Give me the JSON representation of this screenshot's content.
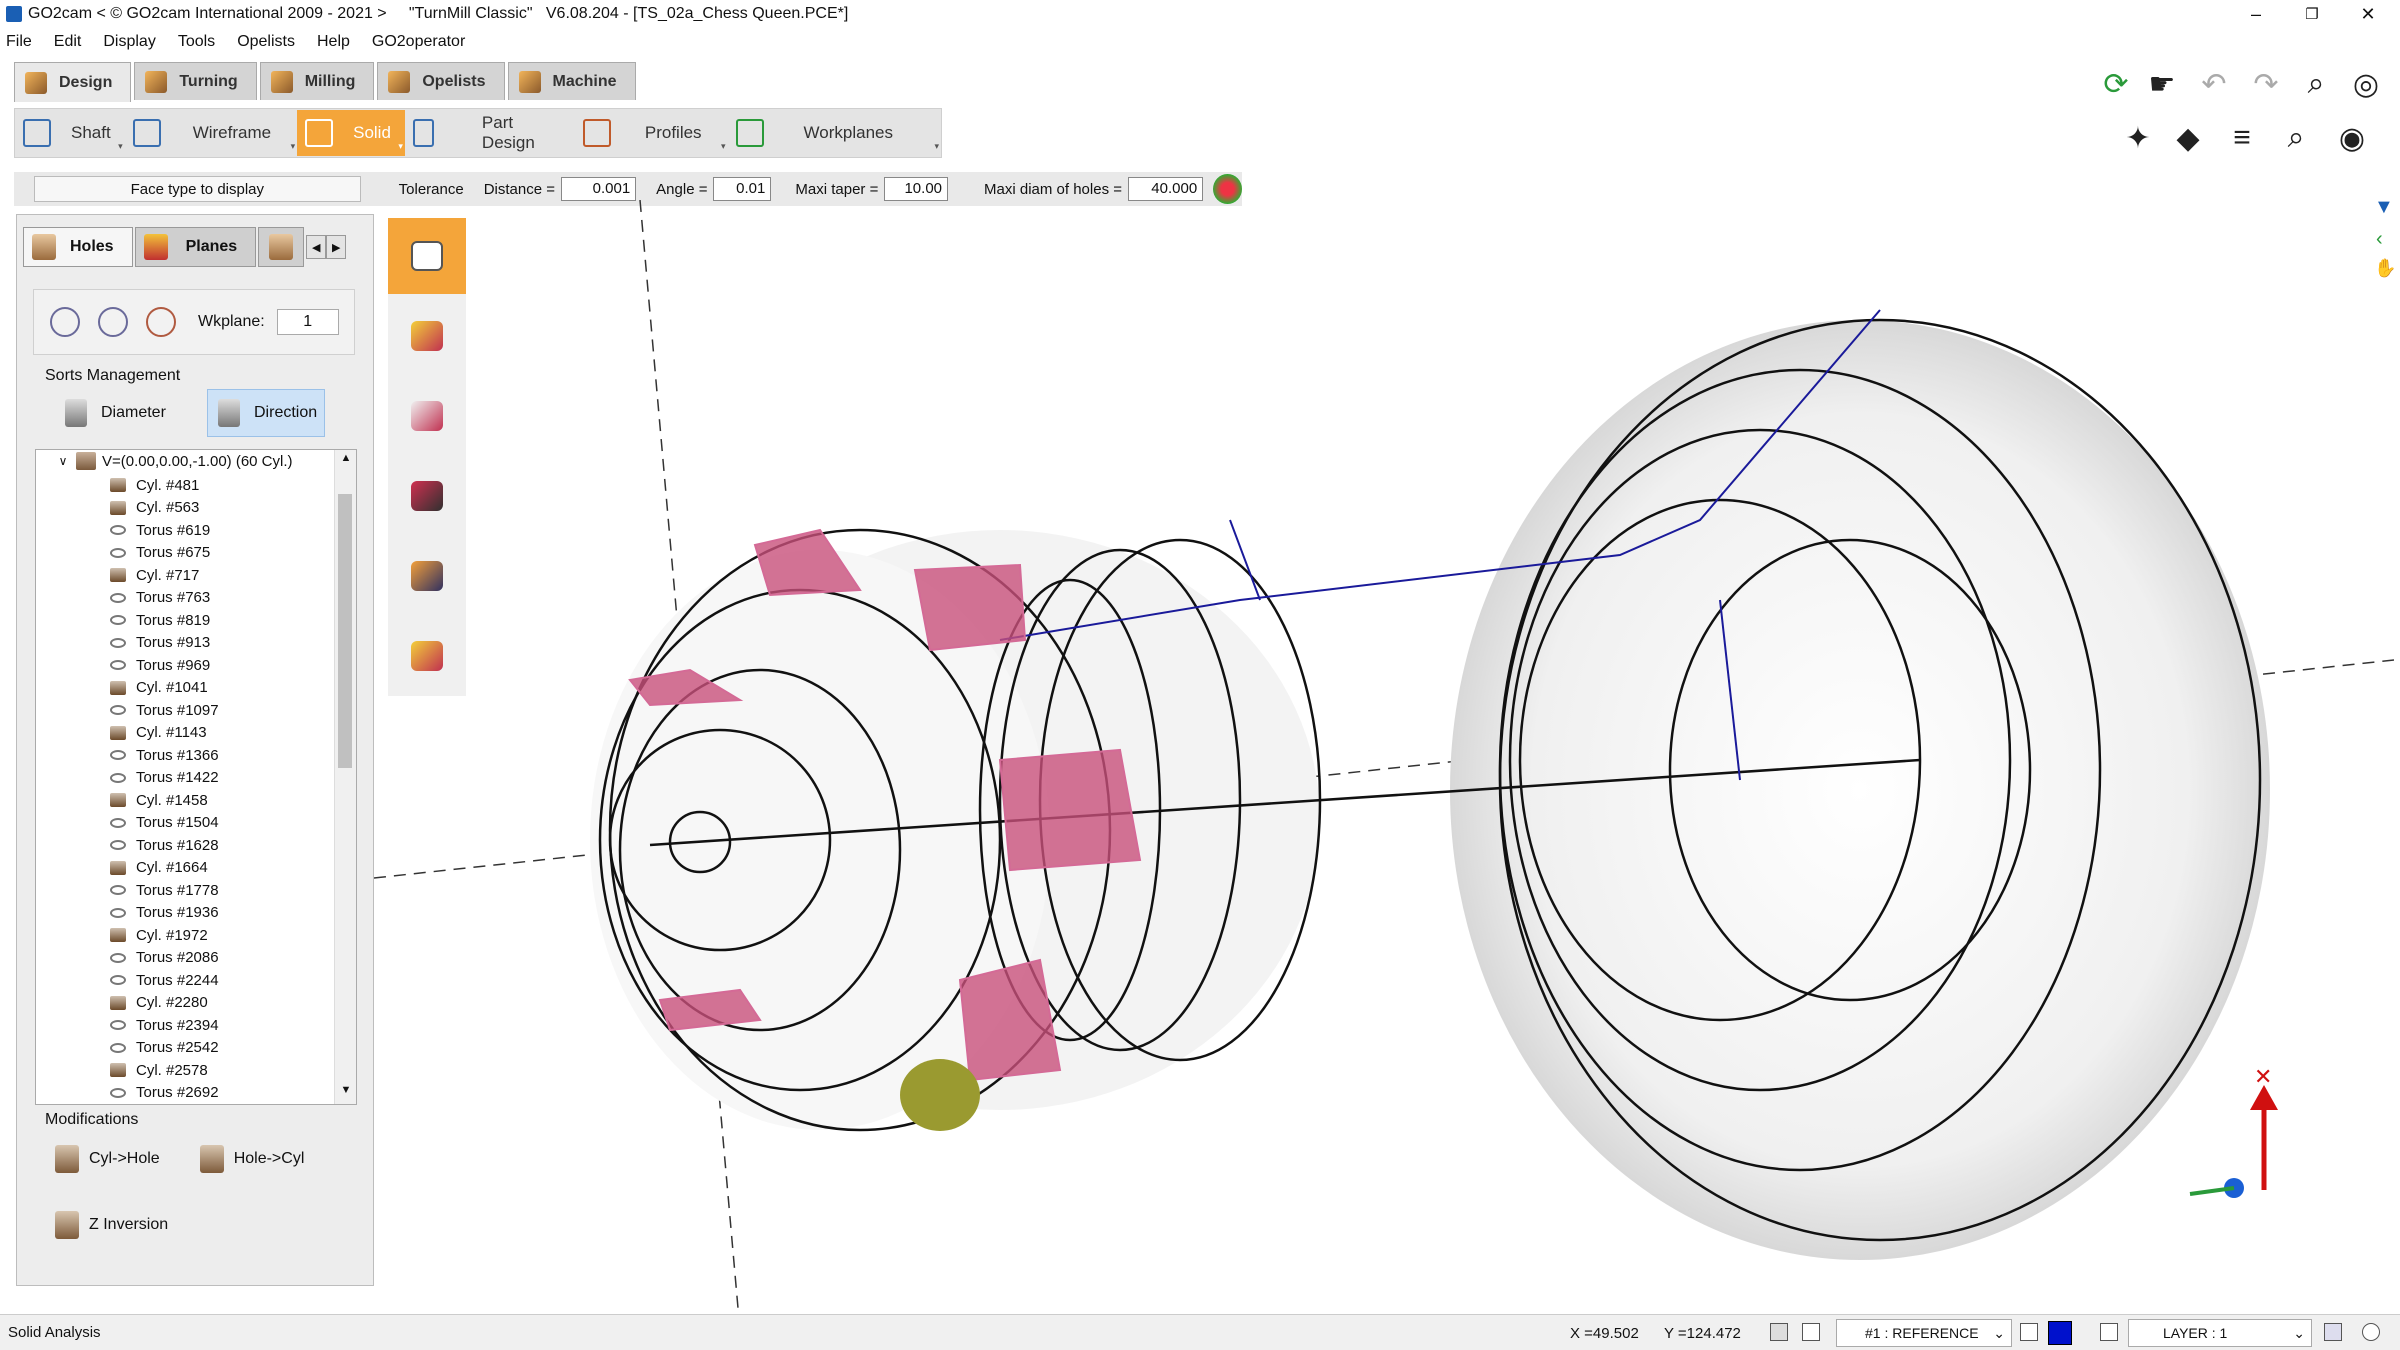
{
  "window": {
    "title": "GO2cam < © GO2cam International 2009 - 2021 >     \"TurnMill Classic\"   V6.08.204 - [TS_02a_Chess Queen.PCE*]",
    "minimize": "–",
    "restore": "❐",
    "close": "✕"
  },
  "menu": [
    "File",
    "Edit",
    "Display",
    "Tools",
    "Opelists",
    "Help",
    "GO2operator"
  ],
  "main_tabs": [
    "Design",
    "Turning",
    "Milling",
    "Opelists",
    "Machine"
  ],
  "toolbar": {
    "shaft": "Shaft",
    "wireframe": "Wireframe",
    "solid": "Solid",
    "part_design": "Part Design",
    "profiles": "Profiles",
    "workplanes": "Workplanes"
  },
  "params": {
    "face_type": "Face type to display",
    "tolerance": "Tolerance",
    "distance_label": "Distance =",
    "distance_value": "0.001",
    "angle_label": "Angle =",
    "angle_value": "0.01",
    "maxi_taper_label": "Maxi taper =",
    "maxi_taper_value": "10.00",
    "maxi_diam_label": "Maxi diam of holes =",
    "maxi_diam_value": "40.000"
  },
  "panel": {
    "tabs": [
      "Holes",
      "Planes"
    ],
    "wkplane_label": "Wkplane:",
    "wkplane_value": "1",
    "sorts_title": "Sorts Management",
    "sort_diameter": "Diameter",
    "sort_direction": "Direction",
    "tree_root": "V=(0.00,0.00,-1.00) (60 Cyl.)",
    "tree_items": [
      {
        "label": "Cyl. #481",
        "kind": "cyl"
      },
      {
        "label": "Cyl. #563",
        "kind": "cyl"
      },
      {
        "label": "Torus #619",
        "kind": "torus"
      },
      {
        "label": "Torus #675",
        "kind": "torus"
      },
      {
        "label": "Cyl. #717",
        "kind": "cyl"
      },
      {
        "label": "Torus #763",
        "kind": "torus"
      },
      {
        "label": "Torus #819",
        "kind": "torus"
      },
      {
        "label": "Torus #913",
        "kind": "torus"
      },
      {
        "label": "Torus #969",
        "kind": "torus"
      },
      {
        "label": "Cyl. #1041",
        "kind": "cyl"
      },
      {
        "label": "Torus #1097",
        "kind": "torus"
      },
      {
        "label": "Cyl. #1143",
        "kind": "cyl"
      },
      {
        "label": "Torus #1366",
        "kind": "torus"
      },
      {
        "label": "Torus #1422",
        "kind": "torus"
      },
      {
        "label": "Cyl. #1458",
        "kind": "cyl"
      },
      {
        "label": "Torus #1504",
        "kind": "torus"
      },
      {
        "label": "Torus #1628",
        "kind": "torus"
      },
      {
        "label": "Cyl. #1664",
        "kind": "cyl"
      },
      {
        "label": "Torus #1778",
        "kind": "torus"
      },
      {
        "label": "Torus #1936",
        "kind": "torus"
      },
      {
        "label": "Cyl. #1972",
        "kind": "cyl"
      },
      {
        "label": "Torus #2086",
        "kind": "torus"
      },
      {
        "label": "Torus #2244",
        "kind": "torus"
      },
      {
        "label": "Cyl. #2280",
        "kind": "cyl"
      },
      {
        "label": "Torus #2394",
        "kind": "torus"
      },
      {
        "label": "Torus #2542",
        "kind": "torus"
      },
      {
        "label": "Cyl. #2578",
        "kind": "cyl"
      },
      {
        "label": "Torus #2692",
        "kind": "torus"
      }
    ],
    "modifications_title": "Modifications",
    "cyl_to_hole": "Cyl->Hole",
    "hole_to_cyl": "Hole->Cyl",
    "z_inversion": "Z Inversion"
  },
  "status": {
    "text": "Solid Analysis",
    "x": "X =49.502",
    "y": "Y =124.472",
    "reference": "#1 : REFERENCE",
    "layer": "LAYER : 1"
  },
  "colors": {
    "accent": "#f4a53a",
    "selection": "#cde2f7",
    "hole_face": "#c8507a",
    "current_color": "#0011cc"
  },
  "icons": {
    "refresh": "refresh-icon",
    "undo": "undo-icon",
    "redo": "redo-icon",
    "zoom": "zoom-icon",
    "glasses": "glasses-icon",
    "eye": "eye-icon",
    "filter": "filter-icon"
  }
}
